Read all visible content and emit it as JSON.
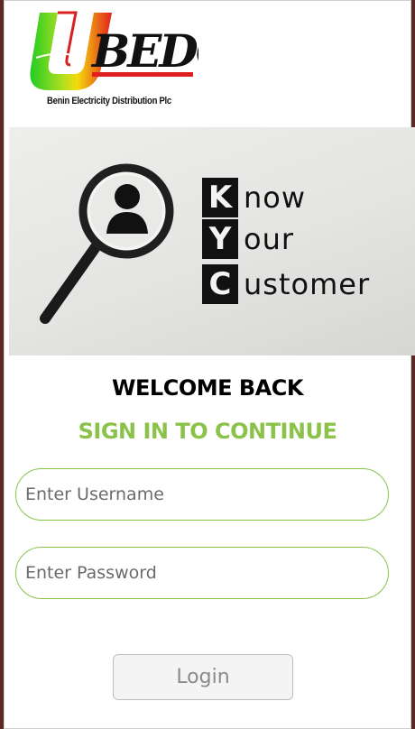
{
  "brand": {
    "logo_text": "BEDC",
    "company_name": "Benin Electricity Distribution Plc",
    "colors": {
      "green": "#33cc33",
      "yellow": "#f5d90a",
      "red": "#e02020",
      "black": "#111111"
    }
  },
  "banner": {
    "letters": [
      "K",
      "Y",
      "C"
    ],
    "words": [
      "now",
      "our",
      "ustomer"
    ],
    "icon": "magnifying-glass-person-icon"
  },
  "form": {
    "welcome": "WELCOME BACK",
    "subtitle": "SIGN IN TO CONTINUE",
    "username": {
      "placeholder": "Enter Username",
      "value": ""
    },
    "password": {
      "placeholder": "Enter Password",
      "value": ""
    },
    "login_label": "Login",
    "accent_color": "#8bc34a"
  }
}
